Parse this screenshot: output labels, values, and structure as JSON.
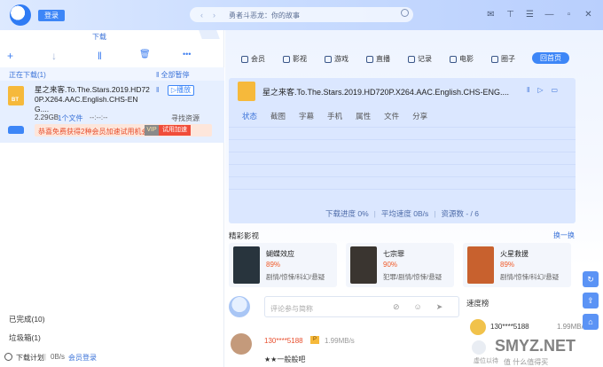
{
  "header": {
    "login": "登录",
    "search_text": "勇者斗恶龙：你的故事",
    "nav_back": "‹",
    "nav_fwd": "›"
  },
  "left": {
    "tab": "下载",
    "toolbar": {
      "add": "+",
      "download": "↓",
      "pause": "‖",
      "delete": "🗑",
      "more": "•••"
    },
    "section_downloading": "正在下载(1)",
    "pause_all": "‖ 全部暂停",
    "task": {
      "name": "星之来客.To.The.Stars.2019.HD720P.X264.AAC.English.CHS-ENG....",
      "play_label": "▷播放",
      "pause_icon": "‖",
      "size": "2.29GB",
      "files": "1个文件",
      "time": "--:--:--",
      "seeking": "寻找资源",
      "promo": "恭喜免费获得2种会员加速试用机会",
      "vip": "VIP",
      "trial": "试用加速"
    },
    "completed": "已完成(10)",
    "trash": "垃圾箱(1)",
    "bottom": {
      "plan": "下载计划",
      "sep": "|",
      "speed": "0B/s",
      "member": "会员登录"
    }
  },
  "right": {
    "nav": [
      {
        "label": "会员"
      },
      {
        "label": "影视"
      },
      {
        "label": "游戏"
      },
      {
        "label": "直播"
      },
      {
        "label": "记录"
      },
      {
        "label": "电影"
      },
      {
        "label": "圈子"
      }
    ],
    "home": "回首页",
    "detail": {
      "title": "星之来客.To.The.Stars.2019.HD720P.X264.AAC.English.CHS-ENG....",
      "tabs": [
        "状态",
        "截图",
        "字幕",
        "手机",
        "属性",
        "文件",
        "分享"
      ],
      "progress": "下载进度 0%",
      "avg_speed": "平均速度 0B/s",
      "sources": "资源数 - / 6"
    },
    "featured_title": "精彩影视",
    "swap": "换一换",
    "movies": [
      {
        "title": "蝴蝶效应",
        "score": "89%",
        "tags": "剧情/惊悚/科幻/悬疑",
        "poster_color": "#28343d"
      },
      {
        "title": "七宗罪",
        "score": "90%",
        "tags": "犯罪/剧情/惊悚/悬疑",
        "poster_color": "#3a3530"
      },
      {
        "title": "火星救援",
        "score": "89%",
        "tags": "剧情/惊悚/科幻/悬疑",
        "poster_color": "#c8612e"
      }
    ],
    "comment_placeholder": "评论参与简称",
    "speed_rank_title": "速度榜",
    "rank": {
      "name": "130****5188",
      "speed": "1.99MB/s",
      "wait": "虚位以待"
    },
    "user": {
      "name": "130****5188",
      "badge": "P",
      "speed": "1.99MB/s",
      "comment": "★★一般般吧"
    },
    "watermark": "SMYZ.NET",
    "watermark_sub": "值 什么值得买"
  }
}
